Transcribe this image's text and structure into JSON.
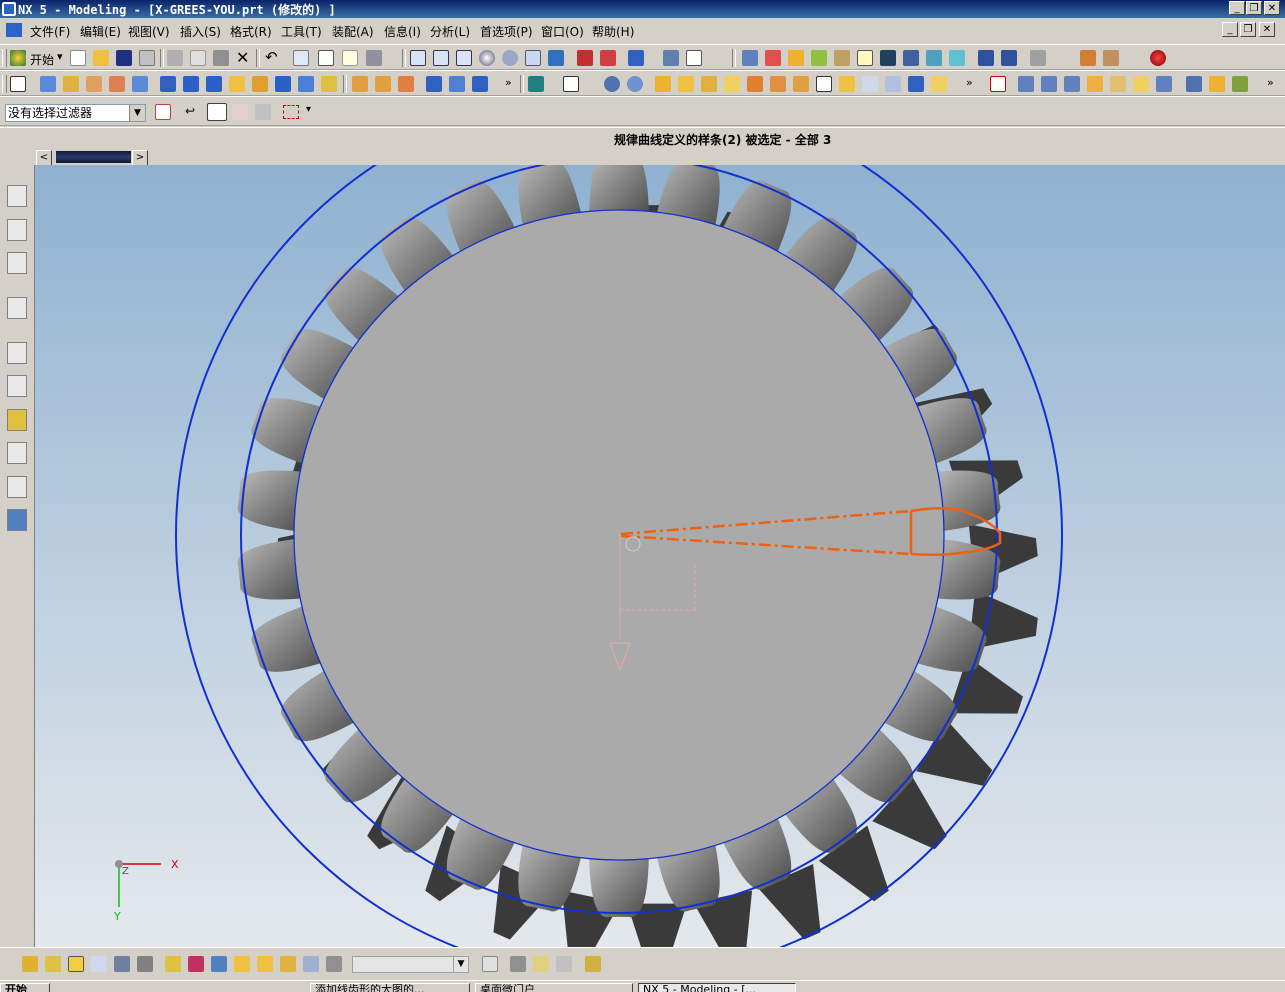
{
  "window": {
    "title": "NX 5 - Modeling - [X-GREES-YOU.prt (修改的) ]"
  },
  "menu": {
    "items": [
      "文件(F)",
      "编辑(E)",
      "视图(V)",
      "插入(S)",
      "格式(R)",
      "工具(T)",
      "装配(A)",
      "信息(I)",
      "分析(L)",
      "首选项(P)",
      "窗口(O)",
      "帮助(H)"
    ]
  },
  "toolbar": {
    "start_label": "开始"
  },
  "selection": {
    "filter_value": "没有选择过滤器"
  },
  "status": {
    "message": "规律曲线定义的样条(2) 被选定 - 全部 3"
  },
  "viewport": {
    "axis_x_label": "X",
    "axis_y_label": "Y",
    "axis_z_label": "Z",
    "gear_teeth": 30,
    "colors": {
      "circle": "#1030d0",
      "highlight": "#f06010",
      "gear": "#aaaaaa",
      "background_top": "#8fb1d0"
    }
  },
  "taskbar": {
    "start": "开始",
    "tasks": [
      "添加线齿形的大图的...",
      "桌面微门户",
      "NX 5 - Modeling - [..."
    ]
  }
}
